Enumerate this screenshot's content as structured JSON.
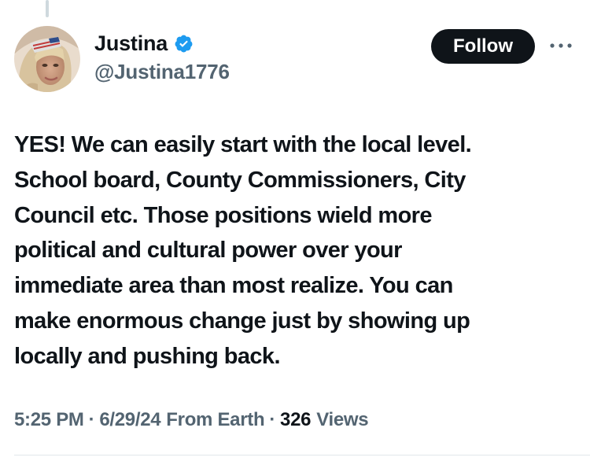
{
  "author": {
    "display_name": "Justina",
    "handle": "@Justina1776",
    "verified": true,
    "verified_color": "#1d9bf0"
  },
  "actions": {
    "follow_label": "Follow",
    "more_icon": "more-horizontal-icon"
  },
  "tweet": {
    "text": "YES! We can easily start with the local level.\nSchool board, County Commissioners, City\nCouncil etc. Those positions wield more\npolitical and cultural power over your\nimmediate area than most realize. You can\nmake enormous change just by showing up\nlocally and pushing back."
  },
  "meta": {
    "time": "5:25 PM",
    "separator": "·",
    "date": "6/29/24",
    "source": "From Earth",
    "views_count": "326",
    "views_label": "Views"
  },
  "colors": {
    "text_primary": "#0f1419",
    "text_secondary": "#536471",
    "follow_bg": "#0f1419",
    "follow_text": "#ffffff"
  }
}
